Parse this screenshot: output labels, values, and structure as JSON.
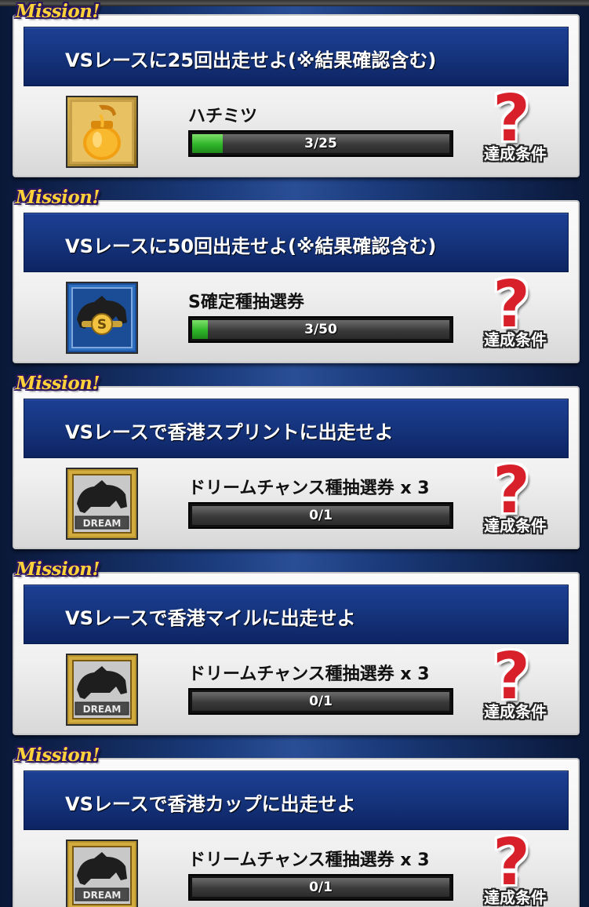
{
  "mission_tag": "Mission!",
  "condition_label": "達成条件",
  "missions": [
    {
      "title": "VSレースに25回出走せよ(※結果確認含む)",
      "reward": "ハチミツ",
      "reward_icon": "honey-jar-icon",
      "progress_text": "3/25",
      "progress_current": 3,
      "progress_total": 25
    },
    {
      "title": "VSレースに50回出走せよ(※結果確認含む)",
      "reward": "S確定種抽選券",
      "reward_icon": "s-ticket-icon",
      "progress_text": "3/50",
      "progress_current": 3,
      "progress_total": 50
    },
    {
      "title": "VSレースで香港スプリントに出走せよ",
      "reward": "ドリームチャンス種抽選券 x 3",
      "reward_icon": "dream-ticket-icon",
      "badge": "DREAM",
      "progress_text": "0/1",
      "progress_current": 0,
      "progress_total": 1
    },
    {
      "title": "VSレースで香港マイルに出走せよ",
      "reward": "ドリームチャンス種抽選券 x 3",
      "reward_icon": "dream-ticket-icon",
      "badge": "DREAM",
      "progress_text": "0/1",
      "progress_current": 0,
      "progress_total": 1
    },
    {
      "title": "VSレースで香港カップに出走せよ",
      "reward": "ドリームチャンス種抽選券 x 3",
      "reward_icon": "dream-ticket-icon",
      "badge": "DREAM",
      "progress_text": "0/1",
      "progress_current": 0,
      "progress_total": 1
    }
  ],
  "colors": {
    "title_bar": "#16357f",
    "progress_fill": "#2fb52a",
    "mission_tag": "#ffd23a",
    "question_mark": "#d8202a"
  }
}
